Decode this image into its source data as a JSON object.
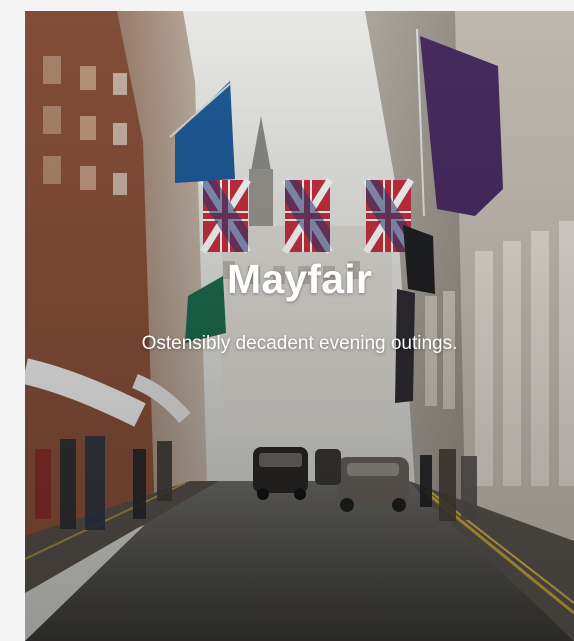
{
  "card": {
    "title": "Mayfair",
    "subtitle": "Ostensibly decadent evening outings."
  },
  "colors": {
    "page_background": "#f4f4f4",
    "overlay_text": "#ffffff",
    "flag_blue": "#1f5d9c",
    "flag_green": "#1e6b4f",
    "flag_purple": "#4a2d63",
    "flag_red": "#c8303e",
    "flag_navy": "#263d7a"
  },
  "icons": [
    "union-jack-flag-icon",
    "blue-banner-icon",
    "purple-banner-icon",
    "green-banner-icon"
  ]
}
